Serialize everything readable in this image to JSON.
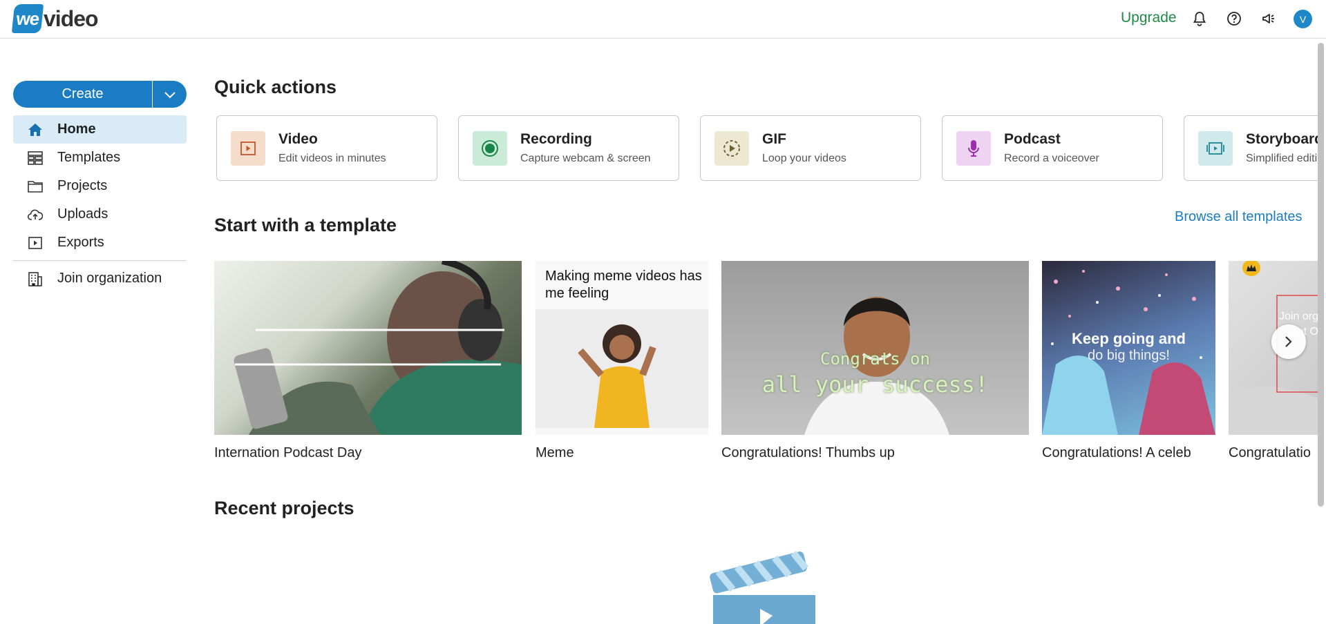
{
  "header": {
    "logo_we": "we",
    "logo_video": "video",
    "upgrade": "Upgrade",
    "avatar_initial": "V",
    "icons": [
      "bell-icon",
      "help-icon",
      "announcement-icon"
    ]
  },
  "sidebar": {
    "create_label": "Create",
    "items": [
      {
        "label": "Home",
        "icon": "home-icon",
        "active": true
      },
      {
        "label": "Templates",
        "icon": "templates-icon"
      },
      {
        "label": "Projects",
        "icon": "folder-icon"
      },
      {
        "label": "Uploads",
        "icon": "cloud-upload-icon"
      },
      {
        "label": "Exports",
        "icon": "export-icon"
      }
    ],
    "join_org": "Join organization"
  },
  "quick_actions": {
    "title": "Quick actions",
    "cards": [
      {
        "title": "Video",
        "subtitle": "Edit videos in minutes",
        "icon": "video-icon",
        "color": "#f6dccb"
      },
      {
        "title": "Recording",
        "subtitle": "Capture webcam & screen",
        "icon": "record-icon",
        "color": "#c9ebd8"
      },
      {
        "title": "GIF",
        "subtitle": "Loop your videos",
        "icon": "gif-loop-icon",
        "color": "#ece8d2"
      },
      {
        "title": "Podcast",
        "subtitle": "Record a voiceover",
        "icon": "microphone-icon",
        "color": "#eed3f3"
      },
      {
        "title": "Storyboard",
        "subtitle": "Simplified editing",
        "icon": "storyboard-icon",
        "color": "#cfe9ec"
      }
    ]
  },
  "templates": {
    "title": "Start with a template",
    "browse_all": "Browse all templates",
    "items": [
      {
        "label": "Internation Podcast Day"
      },
      {
        "label": "Meme",
        "overlay": "Making meme videos has me feeling"
      },
      {
        "label": "Congratulations! Thumbs up",
        "overlay_1": "Congrats on",
        "overlay_2": "all your success!"
      },
      {
        "label": "Congratulations! A celeb",
        "overlay_1": "Keep going and",
        "overlay_2": "do big things!"
      },
      {
        "label": "Congratulatio",
        "overlay": "Join org set O"
      }
    ]
  },
  "recent": {
    "title": "Recent projects"
  }
}
